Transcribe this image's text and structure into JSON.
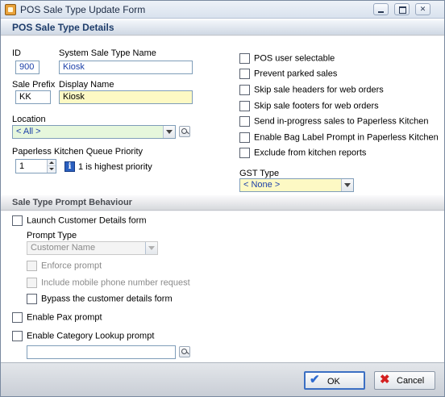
{
  "window": {
    "title": "POS Sale Type Update Form"
  },
  "details": {
    "section_title": "POS Sale Type Details",
    "id_label": "ID",
    "id_value": "900",
    "system_name_label": "System Sale Type Name",
    "system_name_value": "Kiosk",
    "prefix_label": "Sale Prefix",
    "prefix_value": "KK",
    "display_name_label": "Display Name",
    "display_name_value": "Kiosk",
    "location_label": "Location",
    "location_value": "< All >",
    "pk_priority_label": "Paperless Kitchen Queue Priority",
    "pk_priority_value": "1",
    "pk_priority_hint": "1 is highest priority",
    "info_icon_glyph": "i",
    "gst_label": "GST Type",
    "gst_value": "< None >",
    "options": [
      {
        "label": "POS user selectable",
        "checked": false
      },
      {
        "label": "Prevent parked sales",
        "checked": false
      },
      {
        "label": "Skip sale headers for web orders",
        "checked": false
      },
      {
        "label": "Skip sale footers for web orders",
        "checked": false
      },
      {
        "label": "Send in-progress sales to Paperless Kitchen",
        "checked": false
      },
      {
        "label": "Enable Bag Label Prompt in Paperless Kitchen",
        "checked": false
      },
      {
        "label": "Exclude from kitchen reports",
        "checked": false
      }
    ]
  },
  "prompt": {
    "section_title": "Sale Type Prompt Behaviour",
    "launch_customer_label": "Launch Customer Details form",
    "prompt_type_label": "Prompt Type",
    "prompt_type_value": "Customer Name",
    "enforce_label": "Enforce prompt",
    "mobile_label": "Include mobile phone number request",
    "bypass_label": "Bypass the customer details form",
    "pax_label": "Enable Pax prompt",
    "category_label": "Enable Category Lookup prompt",
    "category_value": ""
  },
  "footer": {
    "ok_label": "OK",
    "cancel_label": "Cancel",
    "ok_icon": "check-icon",
    "cancel_icon": "x-icon"
  }
}
